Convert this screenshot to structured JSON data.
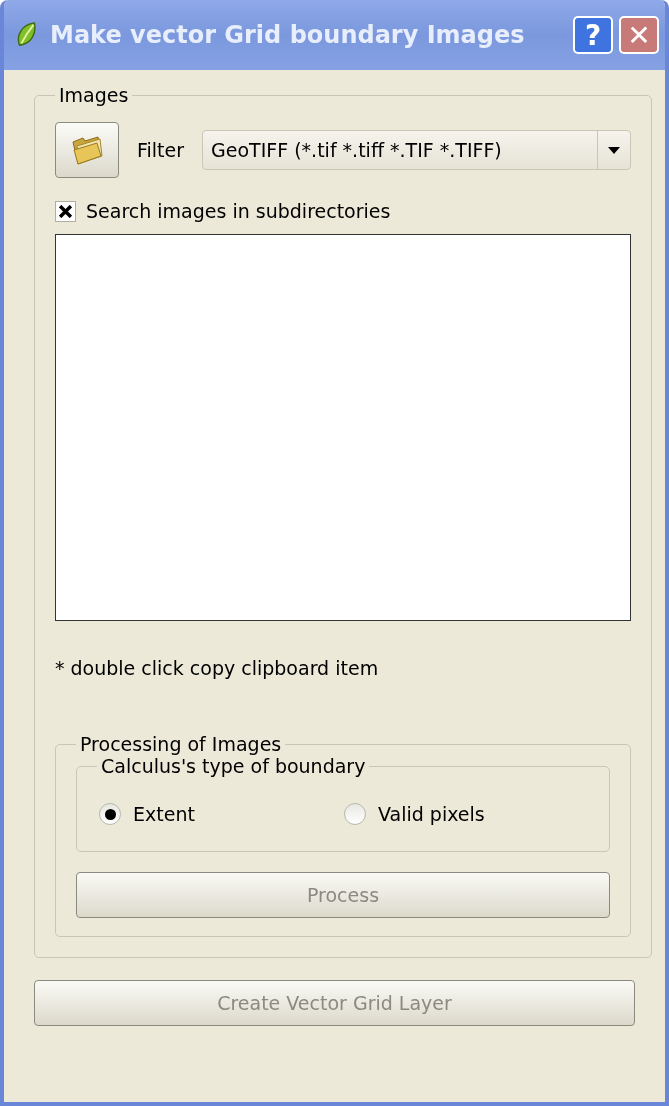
{
  "window": {
    "title": "Make vector Grid boundary Images",
    "help_button": "?",
    "close_button": "✕"
  },
  "images_group": {
    "title": "Images",
    "filter_label": "Filter",
    "filter_value": "GeoTIFF (*.tif *.tiff *.TIF *.TIFF)",
    "search_subdirectories": {
      "label": "Search images in subdirectories",
      "checked": true
    },
    "note": "* double click copy clipboard item"
  },
  "processing_group": {
    "title": "Processing of Images",
    "boundary_group": {
      "title": "Calculus's type of boundary",
      "options": [
        {
          "label": "Extent",
          "selected": true
        },
        {
          "label": "Valid pixels",
          "selected": false
        }
      ]
    },
    "process_button": {
      "label": "Process",
      "disabled": true
    }
  },
  "create_button": {
    "label": "Create Vector Grid Layer",
    "disabled": true
  }
}
